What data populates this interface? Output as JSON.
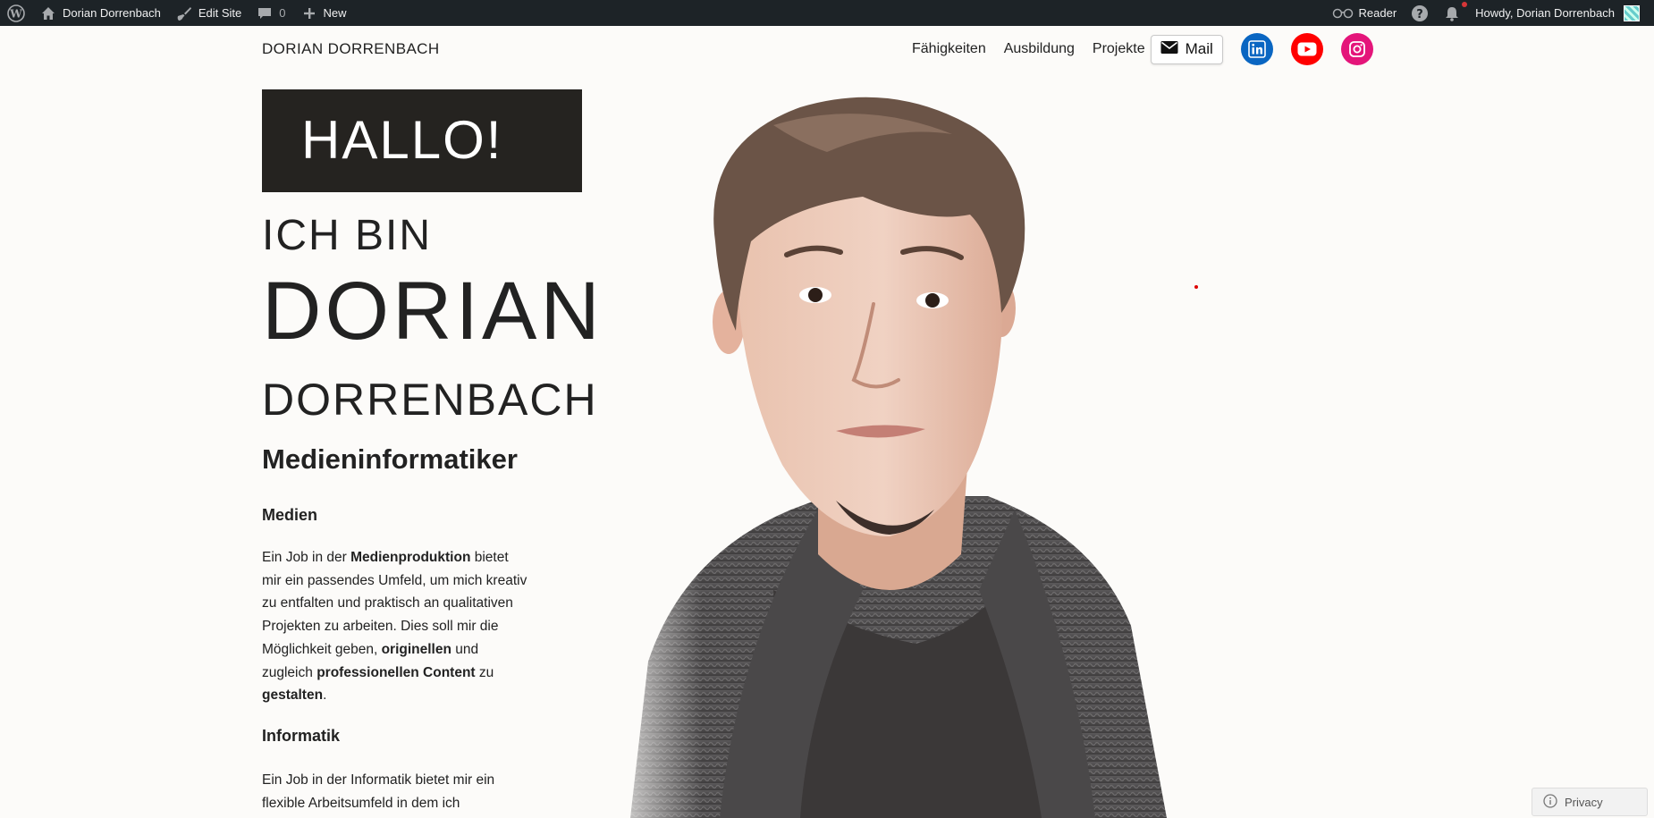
{
  "adminbar": {
    "site_name": "Dorian Dorrenbach",
    "edit_site": "Edit Site",
    "comments_count": "0",
    "new_label": "New",
    "reader_label": "Reader",
    "howdy": "Howdy, Dorian Dorrenbach",
    "icons": [
      "wordpress-logo-icon",
      "home-icon",
      "brush-icon",
      "comment-icon",
      "plus-icon",
      "reader-glasses-icon",
      "help-icon",
      "bell-icon"
    ]
  },
  "header": {
    "site_title": "DORIAN DORRENBACH",
    "nav": [
      "Fähigkeiten",
      "Ausbildung",
      "Projekte"
    ],
    "mail_label": "Mail",
    "social": {
      "linkedin_color": "#0a66c2",
      "youtube_color": "#ff0000",
      "instagram_color": "#e4157a"
    }
  },
  "hero": {
    "greeting": "HALLO!",
    "ich_bin": "ICH BIN",
    "first_name": "DORIAN",
    "last_name": "DORRENBACH",
    "role": "Medieninformatiker"
  },
  "sections": {
    "medien": {
      "heading": "Medien",
      "p1": "Ein Job in der ",
      "b1": "Medienproduktion",
      "p2": " bietet mir ein passendes Umfeld, um mich kreativ zu entfalten und praktisch an qualitativen Projekten zu arbeiten. Dies soll mir die Möglichkeit geben, ",
      "b2": "originellen",
      "p3": " und zugleich ",
      "b3": "professionellen Content",
      "p4": " zu ",
      "b4": "gestalten",
      "p5": "."
    },
    "informatik": {
      "heading": "Informatik",
      "text": "Ein Job in der Informatik bietet mir ein flexible Arbeitsumfeld in dem ich"
    }
  },
  "footer": {
    "privacy_label": "Privacy"
  },
  "colors": {
    "adminbar_bg": "#1d2327",
    "page_bg": "#fcfbf9",
    "hallo_bg": "#252320"
  }
}
